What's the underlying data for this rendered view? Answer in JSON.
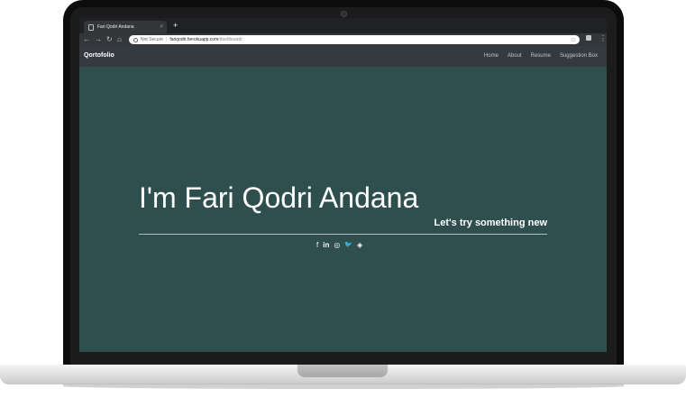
{
  "browser": {
    "tab_title": "Fari Qodri Andana",
    "tab_close": "×",
    "new_tab": "+",
    "security_label": "Not Secure",
    "separator": "|",
    "url_host": "fariqodri.herokuapp.com",
    "url_path": "/dashboard/",
    "back_icon": "←",
    "forward_icon": "→",
    "reload_icon": "↻",
    "home_icon": "⌂",
    "star_icon": "☆",
    "menu_icon": "⋮"
  },
  "navbar": {
    "brand": "Qortofolio",
    "links": [
      "Home",
      "About",
      "Resume",
      "Suggestion Box"
    ]
  },
  "hero": {
    "title": "I'm Fari Qodri Andana",
    "subtitle": "Let's try something new",
    "socials": [
      {
        "icon": "facebook-icon",
        "glyph": "f"
      },
      {
        "icon": "linkedin-icon",
        "glyph": "in"
      },
      {
        "icon": "instagram-icon",
        "glyph": "◎"
      },
      {
        "icon": "twitter-icon",
        "glyph": "🐦"
      },
      {
        "icon": "gitlab-icon",
        "glyph": "◈"
      }
    ]
  },
  "colors": {
    "page_bg": "#2f4f4f",
    "navbar_bg": "#343a40",
    "text": "#ffffff"
  }
}
